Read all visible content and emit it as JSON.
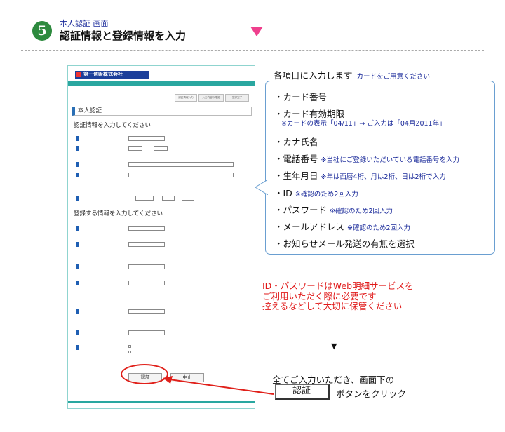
{
  "header": {
    "step_number": "5",
    "subtitle": "本人認証 画面",
    "title": "認証情報と登録情報を入力"
  },
  "screenshot": {
    "company_name": "第一信販株式会社",
    "steps": [
      "認証情報入力",
      "入力内容の確認",
      "登録完了"
    ],
    "section_title": "本人認証",
    "auth_heading": "認証情報を入力してください",
    "register_heading": "登録する情報を入力してください",
    "buttons": {
      "confirm": "認証",
      "cancel": "中止"
    }
  },
  "info": {
    "title": "各項目に入力します",
    "title_note": "カードをご用意ください",
    "items": [
      {
        "label": "・カード番号",
        "note": ""
      },
      {
        "label": "・カード有効期限",
        "note": "※カードの表示「04/11」→ ご入力は「04月2011年」"
      },
      {
        "label": "・カナ氏名",
        "note": ""
      },
      {
        "label": "・電話番号",
        "note": "※当社にご登録いただいている電話番号を入力"
      },
      {
        "label": "・生年月日",
        "note": "※年は西暦4桁、月は2桁、日は2桁で入力"
      },
      {
        "label": "・ID",
        "note": "※確認のため2回入力"
      },
      {
        "label": "・パスワード",
        "note": "※確認のため2回入力"
      },
      {
        "label": "・メールアドレス",
        "note": "※確認のため2回入力"
      },
      {
        "label": "・お知らせメール発送の有無を選択",
        "note": ""
      }
    ]
  },
  "warning": {
    "line1": "ID・パスワードはWeb明細サービスを",
    "line2": "ご利用いただく際に必要です",
    "line3": "控えるなどして大切に保管ください"
  },
  "instruction": {
    "arrow": "▼",
    "line1": "全てご入力いただき、画面下の",
    "button_label": "認証",
    "line2": "ボタンをクリック"
  },
  "colors": {
    "accent_red": "#e01a1a",
    "note_blue": "#1a2a9a",
    "teal": "#2aa7a0",
    "step_green": "#2d8a3e",
    "pink": "#ef3f8d"
  }
}
